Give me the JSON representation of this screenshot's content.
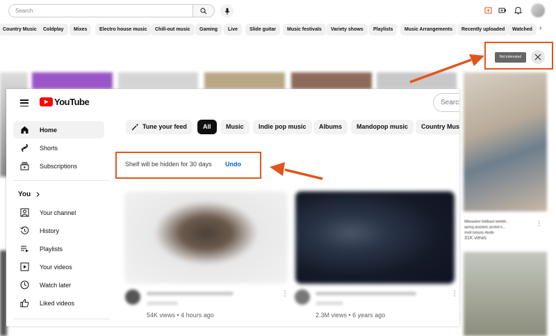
{
  "back": {
    "search_placeholder": "Search",
    "chips": [
      "Country Music",
      "Coldplay",
      "Mixes",
      "Electro house music",
      "Chill-out music",
      "Gaming",
      "Live",
      "Slide guitar",
      "Music festivals",
      "Variety shows",
      "Playlists",
      "Music Arrangements",
      "Recently uploaded",
      "Watched"
    ],
    "tooltip_not_interested": "Not interested",
    "right_video": {
      "title_lines": [
        "Milwaukee foldback twinkle...",
        "spring assisted, pocket k...",
        "#mill #shorts #knife"
      ],
      "views": "31K views"
    }
  },
  "front": {
    "logo_text": "YouTube",
    "search_placeholder": "Search",
    "sidebar": {
      "main": [
        {
          "label": "Home",
          "icon": "home-icon"
        },
        {
          "label": "Shorts",
          "icon": "shorts-icon"
        },
        {
          "label": "Subscriptions",
          "icon": "subscriptions-icon"
        }
      ],
      "you_label": "You",
      "you_items": [
        {
          "label": "Your channel",
          "icon": "channel-icon"
        },
        {
          "label": "History",
          "icon": "history-icon"
        },
        {
          "label": "Playlists",
          "icon": "playlists-icon"
        },
        {
          "label": "Your videos",
          "icon": "videos-icon"
        },
        {
          "label": "Watch later",
          "icon": "clock-icon"
        },
        {
          "label": "Liked videos",
          "icon": "like-icon"
        }
      ]
    },
    "chips": {
      "tune": "Tune your feed",
      "items": [
        "All",
        "Music",
        "Indie pop music",
        "Albums",
        "Mandopop music",
        "Country Music"
      ]
    },
    "shelf": {
      "message": "Shelf will be hidden for 30 days",
      "undo": "Undo"
    },
    "videos": [
      {
        "meta": "54K views • 4 hours ago"
      },
      {
        "meta": "2.3M views • 6 years ago"
      }
    ]
  },
  "colors": {
    "highlight": "#e2541b",
    "link": "#065fd4",
    "brand_red": "#ff0000"
  }
}
